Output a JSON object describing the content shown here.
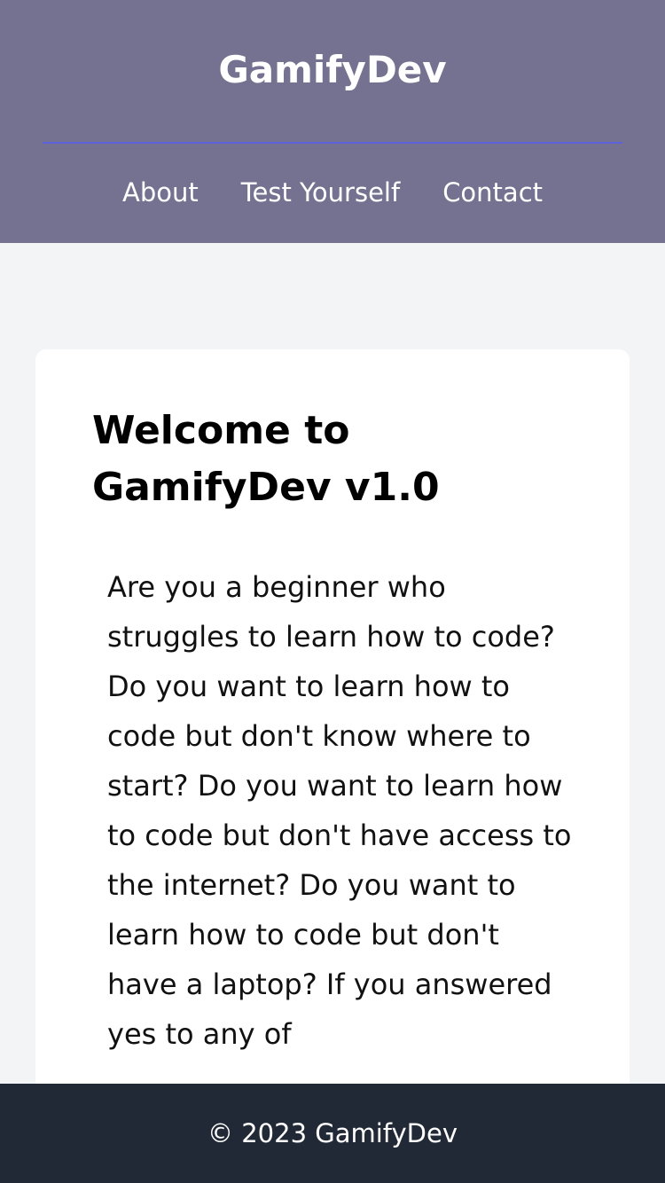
{
  "header": {
    "title": "GamifyDev",
    "nav": [
      {
        "label": "About"
      },
      {
        "label": "Test Yourself"
      },
      {
        "label": "Contact"
      }
    ]
  },
  "main": {
    "heading": "Welcome to GamifyDev v1.0",
    "body": "Are you a beginner who struggles to learn how to code? Do you want to learn how to code but don't know where to start? Do you want to learn how to code but don't have access to the internet? Do you want to learn how to code but don't have a laptop? If you answered yes to any of"
  },
  "footer": {
    "copyright": "© 2023 GamifyDev"
  },
  "colors": {
    "header_bg": "#757191",
    "divider": "#5d62dc",
    "page_bg": "#f3f4f6",
    "card_bg": "#ffffff",
    "footer_bg": "#212936",
    "text_light": "#ffffff",
    "text_dark": "#111111"
  }
}
